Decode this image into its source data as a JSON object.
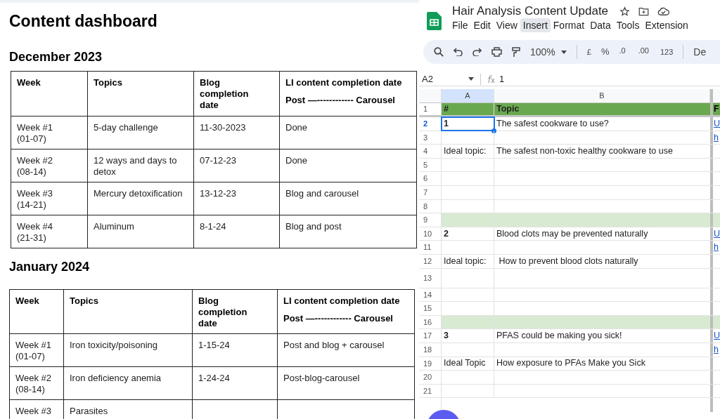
{
  "doc": {
    "title": "Content dashboard",
    "sections": [
      {
        "heading": "December 2023",
        "columns": [
          {
            "label": "Week"
          },
          {
            "label": "Topics"
          },
          {
            "label": "Blog completion date"
          },
          {
            "label": "LI content completion date",
            "sublabel": "Post —------------ Carousel"
          }
        ],
        "rows": [
          [
            "Week #1 (01-07)",
            "5-day challenge",
            "11-30-2023",
            "Done"
          ],
          [
            "Week #2 (08-14)",
            "12 ways and days to detox",
            "07-12-23",
            "Done"
          ],
          [
            "Week #3 (14-21)",
            "Mercury detoxification",
            "13-12-23",
            "Blog and carousel"
          ],
          [
            "Week #4 (21-31)",
            "Aluminum",
            "8-1-24",
            "Blog and post"
          ]
        ]
      },
      {
        "heading": "January 2024",
        "columns": [
          {
            "label": "Week"
          },
          {
            "label": "Topics"
          },
          {
            "label": "Blog completion date"
          },
          {
            "label": "LI content completion date",
            "sublabel": "Post —------------ Carousel"
          }
        ],
        "rows": [
          [
            "Week #1 (01-07)",
            " Iron toxicity/poisoning",
            "1-15-24",
            "Post and blog + carousel"
          ],
          [
            "Week #2 (08-14)",
            "Iron deficiency anemia",
            "1-24-24",
            "Post-blog-carousel"
          ],
          [
            "Week #3",
            "Parasites"
          ]
        ]
      }
    ]
  },
  "sheet": {
    "title": "Hair Analysis Content Update",
    "menu": [
      {
        "label": "File",
        "selected": false
      },
      {
        "label": "Edit",
        "selected": false
      },
      {
        "label": "View",
        "selected": false
      },
      {
        "label": "Insert",
        "selected": true
      },
      {
        "label": "Format",
        "selected": false
      },
      {
        "label": "Data",
        "selected": false
      },
      {
        "label": "Tools",
        "selected": false
      },
      {
        "label": "Extension",
        "selected": false
      }
    ],
    "toolbar": {
      "zoom": "100%",
      "currency": "£",
      "percent": "%",
      "decrease_decimal": ".0",
      "increase_decimal": ".00",
      "number_format": "123",
      "font": "De"
    },
    "cell_ref": "A2",
    "formula": "1",
    "columns": [
      {
        "label": "A",
        "selected": true
      },
      {
        "label": "B",
        "selected": false
      }
    ],
    "rows": [
      {
        "num": "1",
        "kind": "header",
        "selected": false,
        "bold": true,
        "a": "#",
        "b": "Topic",
        "c": "F"
      },
      {
        "num": "2",
        "kind": "data",
        "selected": true,
        "bold": true,
        "a": "1",
        "b": "The safest cookware to use?",
        "c": "U"
      },
      {
        "num": "3",
        "kind": "data",
        "selected": false,
        "c": "h"
      },
      {
        "num": "4",
        "kind": "data",
        "selected": false,
        "bold": false,
        "a": "Ideal topic:",
        "b": "The safest non-toxic healthy cookware to use"
      },
      {
        "num": "5",
        "kind": "data",
        "selected": false
      },
      {
        "num": "6",
        "kind": "data",
        "selected": false
      },
      {
        "num": "7",
        "kind": "data",
        "selected": false
      },
      {
        "num": "8",
        "kind": "data",
        "selected": false
      },
      {
        "num": "9",
        "kind": "band",
        "selected": false
      },
      {
        "num": "10",
        "kind": "data",
        "selected": false,
        "bold": true,
        "a": "2",
        "b": "Blood clots may be prevented naturally",
        "c": "U"
      },
      {
        "num": "11",
        "kind": "data",
        "selected": false,
        "c": "h"
      },
      {
        "num": "12",
        "kind": "data",
        "selected": false,
        "bold": false,
        "a": "Ideal topic:",
        "b": " How to prevent blood clots naturally"
      },
      {
        "num": "13",
        "kind": "tall",
        "selected": false
      },
      {
        "num": "14",
        "kind": "data",
        "selected": false
      },
      {
        "num": "15",
        "kind": "data",
        "selected": false
      },
      {
        "num": "16",
        "kind": "band",
        "selected": false
      },
      {
        "num": "17",
        "kind": "data",
        "selected": false,
        "bold": true,
        "a": "3",
        "b": "PFAS could be making you sick!",
        "c": "U"
      },
      {
        "num": "18",
        "kind": "data",
        "selected": false,
        "c": "h"
      },
      {
        "num": "19",
        "kind": "data",
        "selected": false,
        "bold": false,
        "a": "Ideal Topic",
        "b": "How exposure to PFAs Make you Sick"
      },
      {
        "num": "20",
        "kind": "data",
        "selected": false
      },
      {
        "num": "21",
        "kind": "data",
        "selected": false
      }
    ]
  }
}
